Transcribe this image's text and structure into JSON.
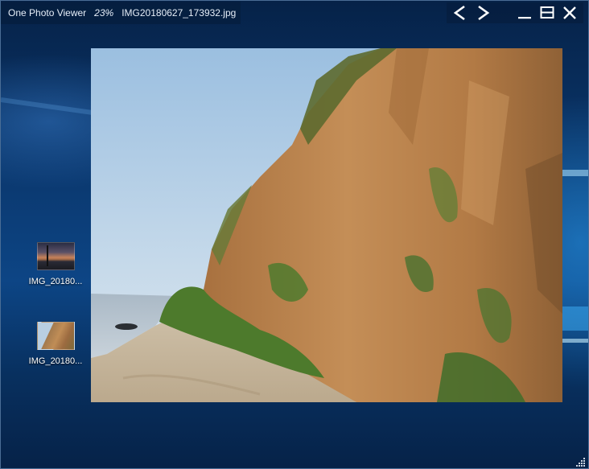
{
  "titlebar": {
    "app_name": "One Photo Viewer",
    "zoom": "23%",
    "file_name": "IMG20180627_173932.jpg"
  },
  "controls": {
    "prev_icon": "chevron-left-icon",
    "next_icon": "chevron-right-icon",
    "minimize_icon": "minimize-icon",
    "maximize_icon": "maximize-icon",
    "close_icon": "close-icon"
  },
  "thumbnails": [
    {
      "label": "IMG_20180..."
    },
    {
      "label": "IMG_20180..."
    }
  ],
  "colors": {
    "window_border": "#4a6d95",
    "desktop_blue": "#0b3a72",
    "title_text": "#e6eef8"
  }
}
